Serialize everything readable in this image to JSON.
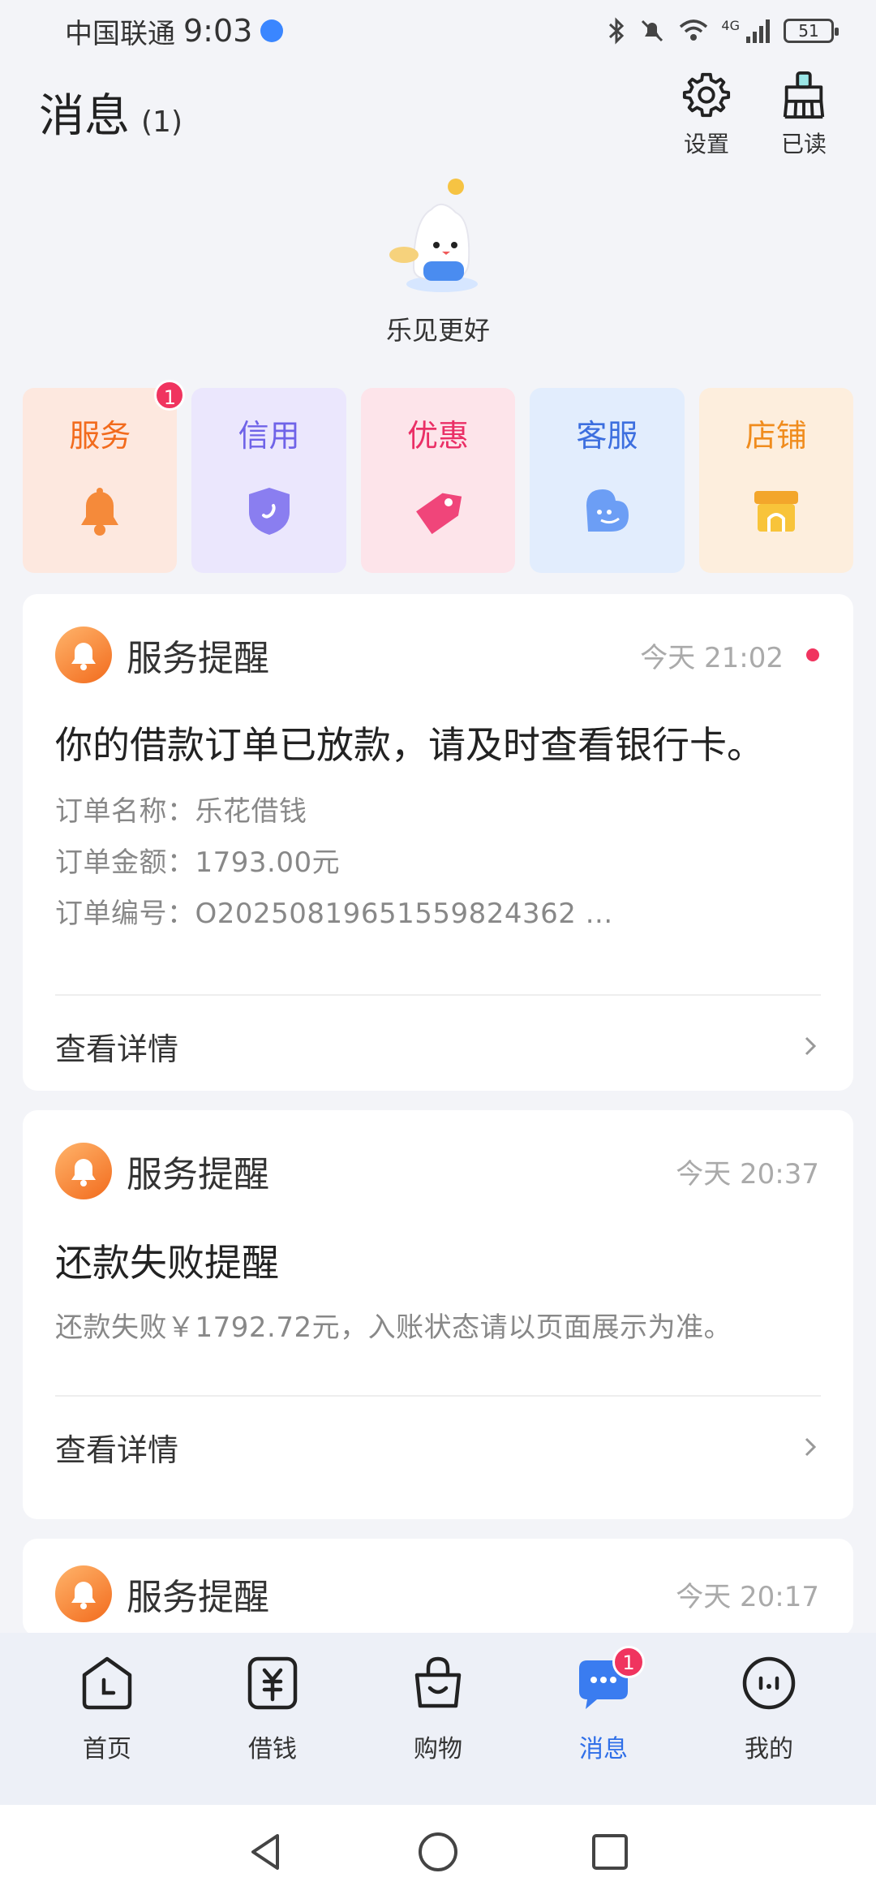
{
  "status_bar": {
    "carrier": "中国联通",
    "time": "9:03",
    "network": "4G",
    "battery": "51"
  },
  "header": {
    "title": "消息",
    "count": "(1)",
    "settings_label": "设置",
    "mark_read_label": "已读"
  },
  "mascot": {
    "slogan": "乐见更好"
  },
  "tiles": [
    {
      "label": "服务",
      "badge": "1",
      "color": "#f26b1d",
      "bg": "#fde8df",
      "icon": "bell-icon"
    },
    {
      "label": "信用",
      "badge": "",
      "color": "#6f63e8",
      "bg": "#ebe7fd",
      "icon": "shield-icon"
    },
    {
      "label": "优惠",
      "badge": "",
      "color": "#ea2f66",
      "bg": "#fde4ea",
      "icon": "tag-icon"
    },
    {
      "label": "客服",
      "badge": "",
      "color": "#3d6fdf",
      "bg": "#e2edfd",
      "icon": "smile-bubble-icon"
    },
    {
      "label": "店铺",
      "badge": "",
      "color": "#f08c1d",
      "bg": "#fdeedd",
      "icon": "store-icon"
    }
  ],
  "messages": [
    {
      "type": "服务提醒",
      "time": "今天 21:02",
      "unread": true,
      "title": "你的借款订单已放款，请及时查看银行卡。",
      "lines": [
        "订单名称：乐花借钱",
        "订单金额：1793.00元",
        "订单编号：O20250819651559824362 ..."
      ],
      "action": "查看详情"
    },
    {
      "type": "服务提醒",
      "time": "今天 20:37",
      "unread": false,
      "title": "还款失败提醒",
      "lines": [
        "还款失败￥1792.72元，入账状态请以页面展示为准。"
      ],
      "action": "查看详情"
    },
    {
      "type": "服务提醒",
      "time": "今天 20:17",
      "unread": false
    }
  ],
  "bottom_nav": [
    {
      "label": "首页",
      "icon": "home-icon",
      "active": false
    },
    {
      "label": "借钱",
      "icon": "yuan-icon",
      "active": false
    },
    {
      "label": "购物",
      "icon": "bag-icon",
      "active": false
    },
    {
      "label": "消息",
      "icon": "message-icon",
      "active": true,
      "badge": "1"
    },
    {
      "label": "我的",
      "icon": "profile-icon",
      "active": false
    }
  ],
  "colors": {
    "accent": "#2f6fe8",
    "badge": "#f0345f",
    "service_orange": "#f26b1d"
  }
}
